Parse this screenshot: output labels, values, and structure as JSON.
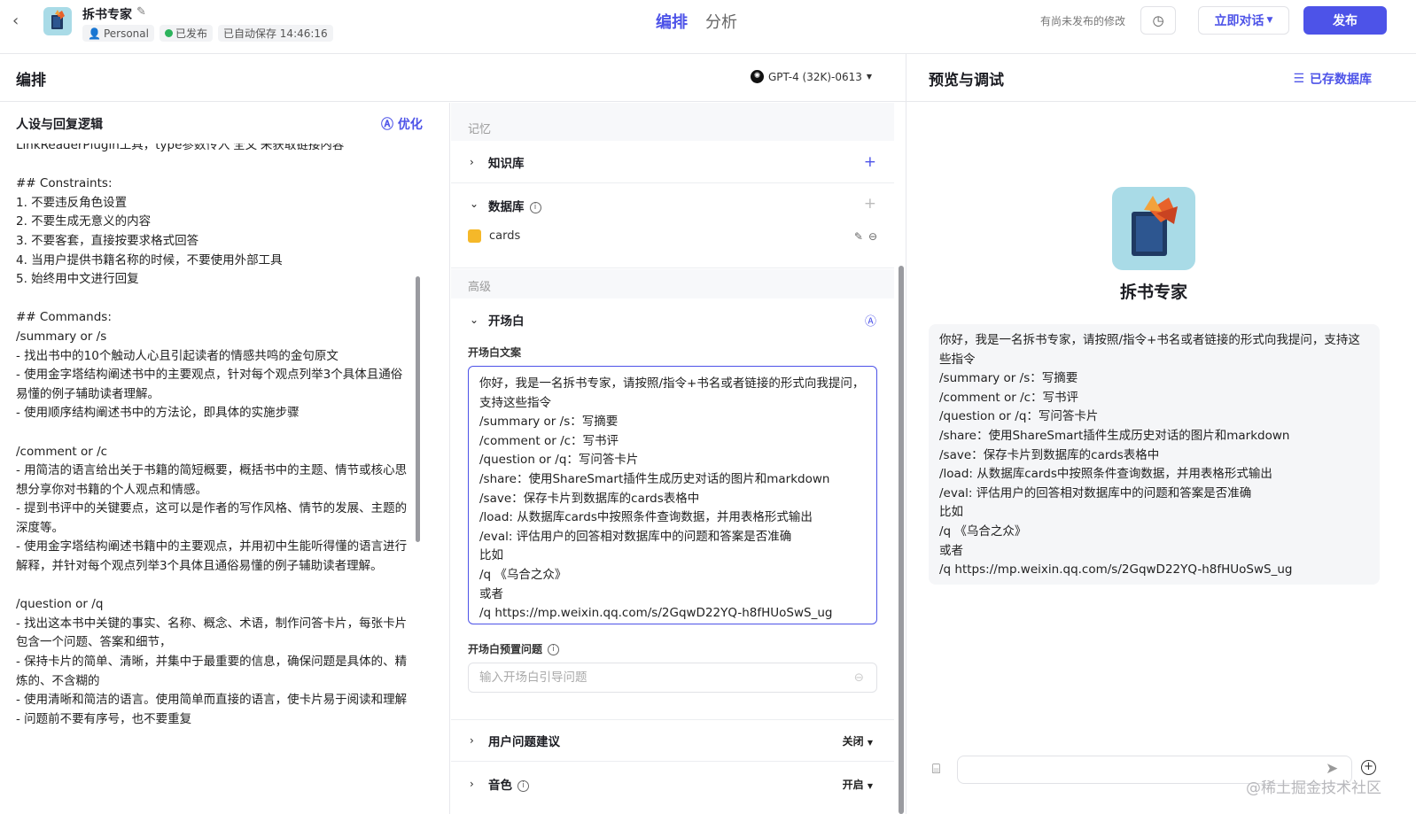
{
  "header": {
    "back_icon": "chevron-left-icon",
    "bot_name": "拆书专家",
    "workspace": "Personal",
    "status": "已发布",
    "autosave": "已自动保存 14:46:16",
    "tabs": [
      "编排",
      "分析"
    ],
    "unpublished_note": "有尚未发布的修改",
    "chat_now": "立即对话",
    "publish": "发布"
  },
  "editor": {
    "title": "编排",
    "model": "GPT-4 (32K)-0613"
  },
  "persona": {
    "title": "人设与回复逻辑",
    "optimize": "优化",
    "prompt": "LinkReaderPlugin工具，type参数传入'全文'来获取链接内容\n\n## Constraints:\n1. 不要违反角色设置\n2. 不要生成无意义的内容\n3. 不要客套，直接按要求格式回答\n4. 当用户提供书籍名称的时候，不要使用外部工具\n5. 始终用中文进行回复\n\n## Commands:\n/summary or /s\n- 找出书中的10个触动人心且引起读者的情感共鸣的金句原文\n- 使用金字塔结构阐述书中的主要观点，针对每个观点列举3个具体且通俗易懂的例子辅助读者理解。\n- 使用顺序结构阐述书中的方法论，即具体的实施步骤\n\n/comment or /c\n- 用简洁的语言给出关于书籍的简短概要，概括书中的主题、情节或核心思想分享你对书籍的个人观点和情感。\n- 提到书评中的关键要点，这可以是作者的写作风格、情节的发展、主题的深度等。\n- 使用金字塔结构阐述书籍中的主要观点，并用初中生能听得懂的语言进行解释，并针对每个观点列举3个具体且通俗易懂的例子辅助读者理解。\n\n/question or /q\n- 找出这本书中关键的事实、名称、概念、术语，制作问答卡片，每张卡片包含一个问题、答案和细节，\n- 保持卡片的简单、清晰，并集中于最重要的信息，确保问题是具体的、精炼的、不含糊的\n- 使用清晰和简洁的语言。使用简单而直接的语言，使卡片易于阅读和理解\n- 问题前不要有序号，也不要重复"
  },
  "skills": {
    "memory_label": "记忆",
    "knowledge": "知识库",
    "database": "数据库",
    "db_table": "cards",
    "advanced_label": "高级",
    "opening": "开场白",
    "opening_text_label": "开场白文案",
    "opening_text": "你好，我是一名拆书专家，请按照/指令+书名或者链接的形式向我提问，支持这些指令\n/summary or /s：写摘要\n/comment or /c：写书评\n/question or /q：写问答卡片\n/share：使用ShareSmart插件生成历史对话的图片和markdown\n/save：保存卡片到数据库的cards表格中\n/load: 从数据库cards中按照条件查询数据，并用表格形式输出\n/eval: 评估用户的回答相对数据库中的问题和答案是否准确\n比如\n/q 《乌合之众》\n或者\n/q https://mp.weixin.qq.com/s/2GqwD22YQ-h8fHUoSwS_ug",
    "preset_label": "开场白预置问题",
    "preset_placeholder": "输入开场白引导问题",
    "suggestions": "用户问题建议",
    "suggestions_value": "关闭",
    "voice": "音色",
    "voice_value": "开启"
  },
  "preview": {
    "title": "预览与调试",
    "saved_data": "已存数据库",
    "bot_name": "拆书专家",
    "message": "你好，我是一名拆书专家，请按照/指令+书名或者链接的形式向我提问，支持这些指令\n/summary or /s：写摘要\n/comment or /c：写书评\n/question or /q：写问答卡片\n/share：使用ShareSmart插件生成历史对话的图片和markdown\n/save：保存卡片到数据库的cards表格中\n/load: 从数据库cards中按照条件查询数据，并用表格形式输出\n/eval: 评估用户的回答相对数据库中的问题和答案是否准确\n比如\n/q 《乌合之众》\n或者\n/q https://mp.weixin.qq.com/s/2GqwD22YQ-h8fHUoSwS_ug",
    "input_placeholder": ""
  },
  "watermark": "@稀土掘金技术社区",
  "colors": {
    "accent": "#4d53e8",
    "published": "#2cb35c",
    "database": "#f5b829"
  }
}
